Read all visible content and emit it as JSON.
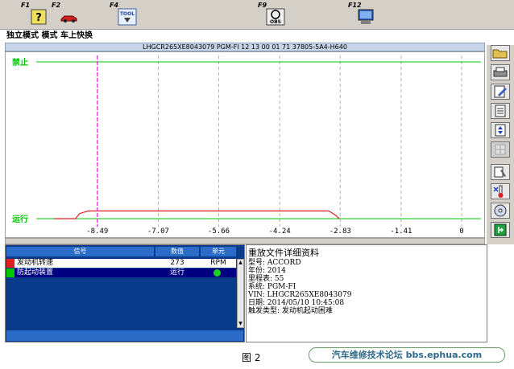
{
  "toolbar": {
    "keys": [
      {
        "label": "F1",
        "icon": "help-icon"
      },
      {
        "label": "F2",
        "icon": "vehicle-icon"
      },
      {
        "label": "F4",
        "icon": "tool-icon",
        "icon_text": "TOOL"
      },
      {
        "label": "F9",
        "icon": "obs-icon",
        "icon_text": "OBS"
      },
      {
        "label": "F12",
        "icon": "monitor-icon"
      }
    ]
  },
  "mode_bar": {
    "text": "独立模式 模式 车上快换"
  },
  "title_strip": {
    "text": "LHGCR265XE8043079  PGM-FI  12 13 00 01 71  37805-5A4-H640"
  },
  "graph": {
    "upper_label": "禁止",
    "lower_label": "运行",
    "x_ticks": [
      "-8.49",
      "-7.07",
      "-5.66",
      "-4.24",
      "-2.83",
      "-1.41",
      "0"
    ],
    "colors": {
      "green": "#00c800",
      "signal": "#e02020",
      "cursor": "#e020e0",
      "grid": "#b4b4b4"
    }
  },
  "chart_data": {
    "type": "line",
    "xlim": [
      -9.5,
      0
    ],
    "x_ticks": [
      -8.49,
      -7.07,
      -5.66,
      -4.24,
      -2.83,
      -1.41,
      0
    ],
    "levels": [
      "运行",
      "禁止"
    ],
    "series": [
      {
        "x": [
          -9.5,
          -9.0,
          -8.9,
          -8.7,
          -3.1,
          -2.95,
          -2.85
        ],
        "y": [
          0,
          0,
          0.04,
          0.06,
          0.06,
          0.03,
          0
        ]
      }
    ],
    "cursor_x": -8.49
  },
  "signal_table": {
    "headers": {
      "signal": "信号",
      "value": "数值",
      "unit": "单元"
    },
    "rows": [
      {
        "signal": "发动机转速",
        "value": "273",
        "unit": "RPM",
        "color": "#e02020"
      },
      {
        "signal": "防起动装置",
        "value": "运行",
        "unit": "",
        "color": "#00c800"
      }
    ]
  },
  "detail": {
    "title": "重放文件详细资料",
    "lines": [
      "型号: ACCORD",
      "年份: 2014",
      "里程表: 55",
      "系统: PGM-FI",
      "VIN: LHGCR265XE8043079",
      "日期: 2014/05/10 10:45:08",
      "触发类型: 发动机起动困难"
    ]
  },
  "caption": {
    "figure": "图 2",
    "forum": "汽车维修技术论坛 bbs.ephua.com"
  }
}
